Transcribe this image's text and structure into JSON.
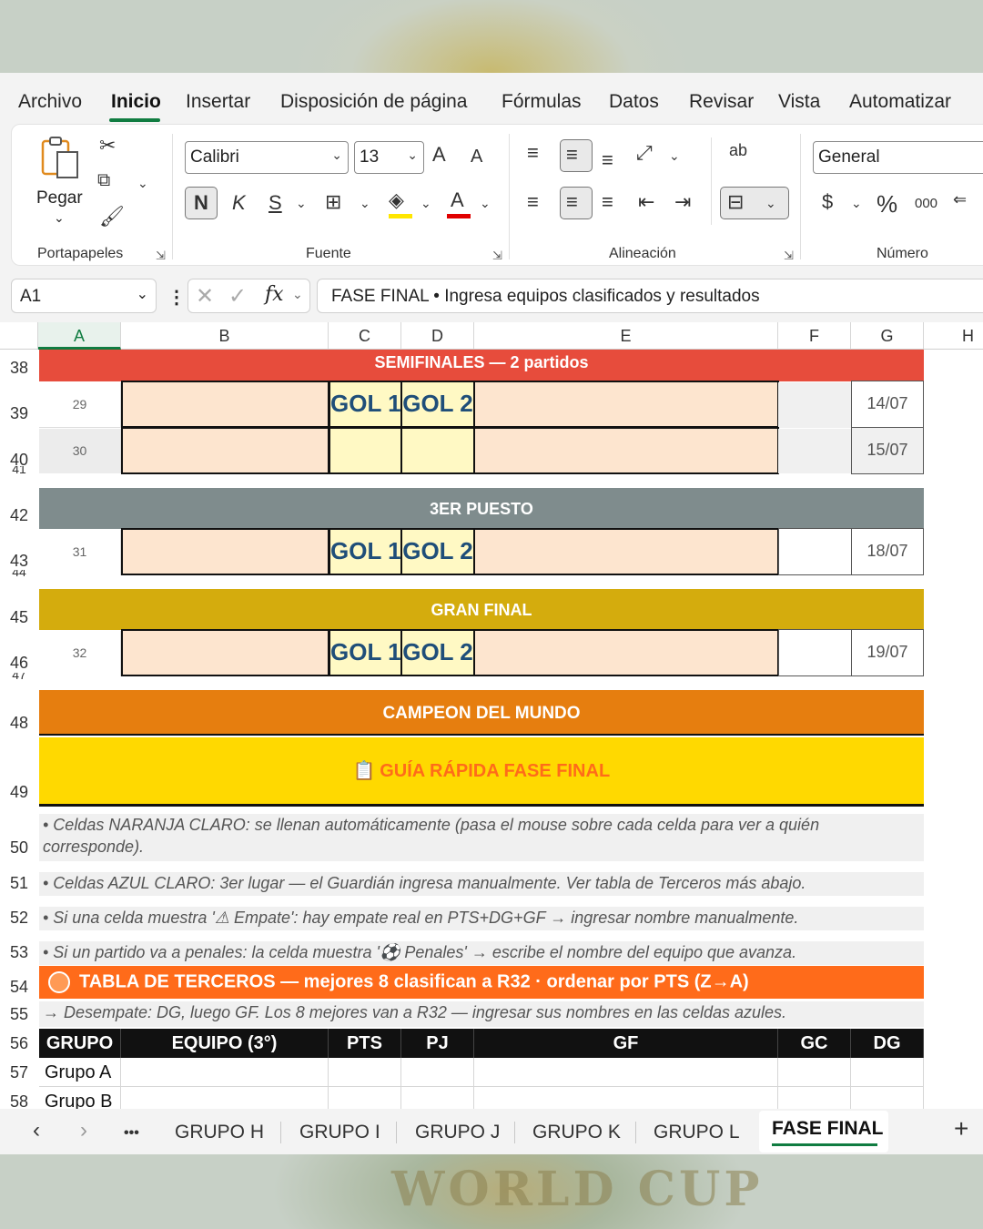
{
  "menu": {
    "items": [
      "Archivo",
      "Inicio",
      "Insertar",
      "Disposición de página",
      "Fórmulas",
      "Datos",
      "Revisar",
      "Vista",
      "Automatizar"
    ],
    "active": "Inicio"
  },
  "ribbon": {
    "clipboard": {
      "paste_label": "Pegar",
      "group_label": "Portapapeles"
    },
    "font": {
      "family": "Calibri",
      "size": "13",
      "group_label": "Fuente",
      "bold_label": "N",
      "italic_label": "K",
      "underline_label": "S",
      "grow_label": "A",
      "shrink_label": "A",
      "color_label": "A"
    },
    "alignment": {
      "group_label": "Alineación",
      "wrap_label": "ab"
    },
    "number": {
      "format": "General",
      "group_label": "Número",
      "currency_label": "$",
      "percent_label": "%",
      "thousands_label": "000"
    },
    "colors": {
      "fill": "#ffe600",
      "font": "#e00000",
      "accent": "#107c41"
    }
  },
  "formula_bar": {
    "name_box": "A1",
    "fx_label": "fx",
    "content": "FASE FINAL • Ingresa equipos clasificados y resultados"
  },
  "columns": [
    "A",
    "B",
    "C",
    "D",
    "E",
    "F",
    "G",
    "H"
  ],
  "rows": [
    "38",
    "39",
    "40",
    "41",
    "42",
    "43",
    "44",
    "45",
    "46",
    "47",
    "48",
    "49",
    "50",
    "51",
    "52",
    "53",
    "54",
    "55",
    "56",
    "57",
    "58"
  ],
  "sections": {
    "semis": "SEMIFINALES  —  2 partidos",
    "third": "3ER PUESTO",
    "final": "GRAN FINAL",
    "champion": "CAMPEON DEL MUNDO",
    "guide": "GUÍA RÁPIDA FASE FINAL",
    "guide_icon": "clipboard-icon"
  },
  "matches": [
    {
      "num": "29",
      "goal1": "GOL 1",
      "goal2": "GOL 2",
      "date": "14/07"
    },
    {
      "num": "30",
      "goal1": "",
      "goal2": "",
      "date": "15/07"
    },
    {
      "num": "31",
      "goal1": "GOL 1",
      "goal2": "GOL 2",
      "date": "18/07"
    },
    {
      "num": "32",
      "goal1": "GOL 1",
      "goal2": "GOL 2",
      "date": "19/07"
    }
  ],
  "notes": [
    "• Celdas NARANJA CLARO: se llenan automáticamente (pasa el mouse sobre cada celda para ver a quién corresponde).",
    "• Celdas AZUL CLARO: 3er lugar — el Guardián ingresa manualmente. Ver tabla de Terceros más abajo.",
    "• Si una celda muestra '⚠ Empate': hay empate real en PTS+DG+GF → ingresar nombre manualmente.",
    "• Si un partido va a penales: la celda muestra '⚽ Penales' → escribe el nombre del equipo que avanza."
  ],
  "third_table": {
    "title": "TABLA DE TERCEROS — mejores 8 clasifican a R32 · ordenar por PTS (Z→A)",
    "tiebreak": "→ Desempate: DG, luego GF. Los 8 mejores van a R32 — ingresar sus nombres en las celdas azules.",
    "headers": [
      "GRUPO",
      "EQUIPO (3°)",
      "PTS",
      "PJ",
      "GF",
      "GC",
      "DG"
    ],
    "rows": [
      "Grupo A",
      "Grupo B"
    ]
  },
  "sheet_tabs": {
    "items": [
      "GRUPO H",
      "GRUPO I",
      "GRUPO J",
      "GRUPO K",
      "GRUPO L",
      "FASE FINAL"
    ],
    "active": "FASE FINAL",
    "more_label": "•••",
    "add_label": "+"
  },
  "background": {
    "watermark_text": "WORLD CUP"
  },
  "band_colors": {
    "semis": "#e74c3c",
    "third": "#7f8c8d",
    "final": "#d4ac0d",
    "champion": "#e67e0f",
    "guide": "#ffd900",
    "third_table": "#ff6b1a"
  }
}
